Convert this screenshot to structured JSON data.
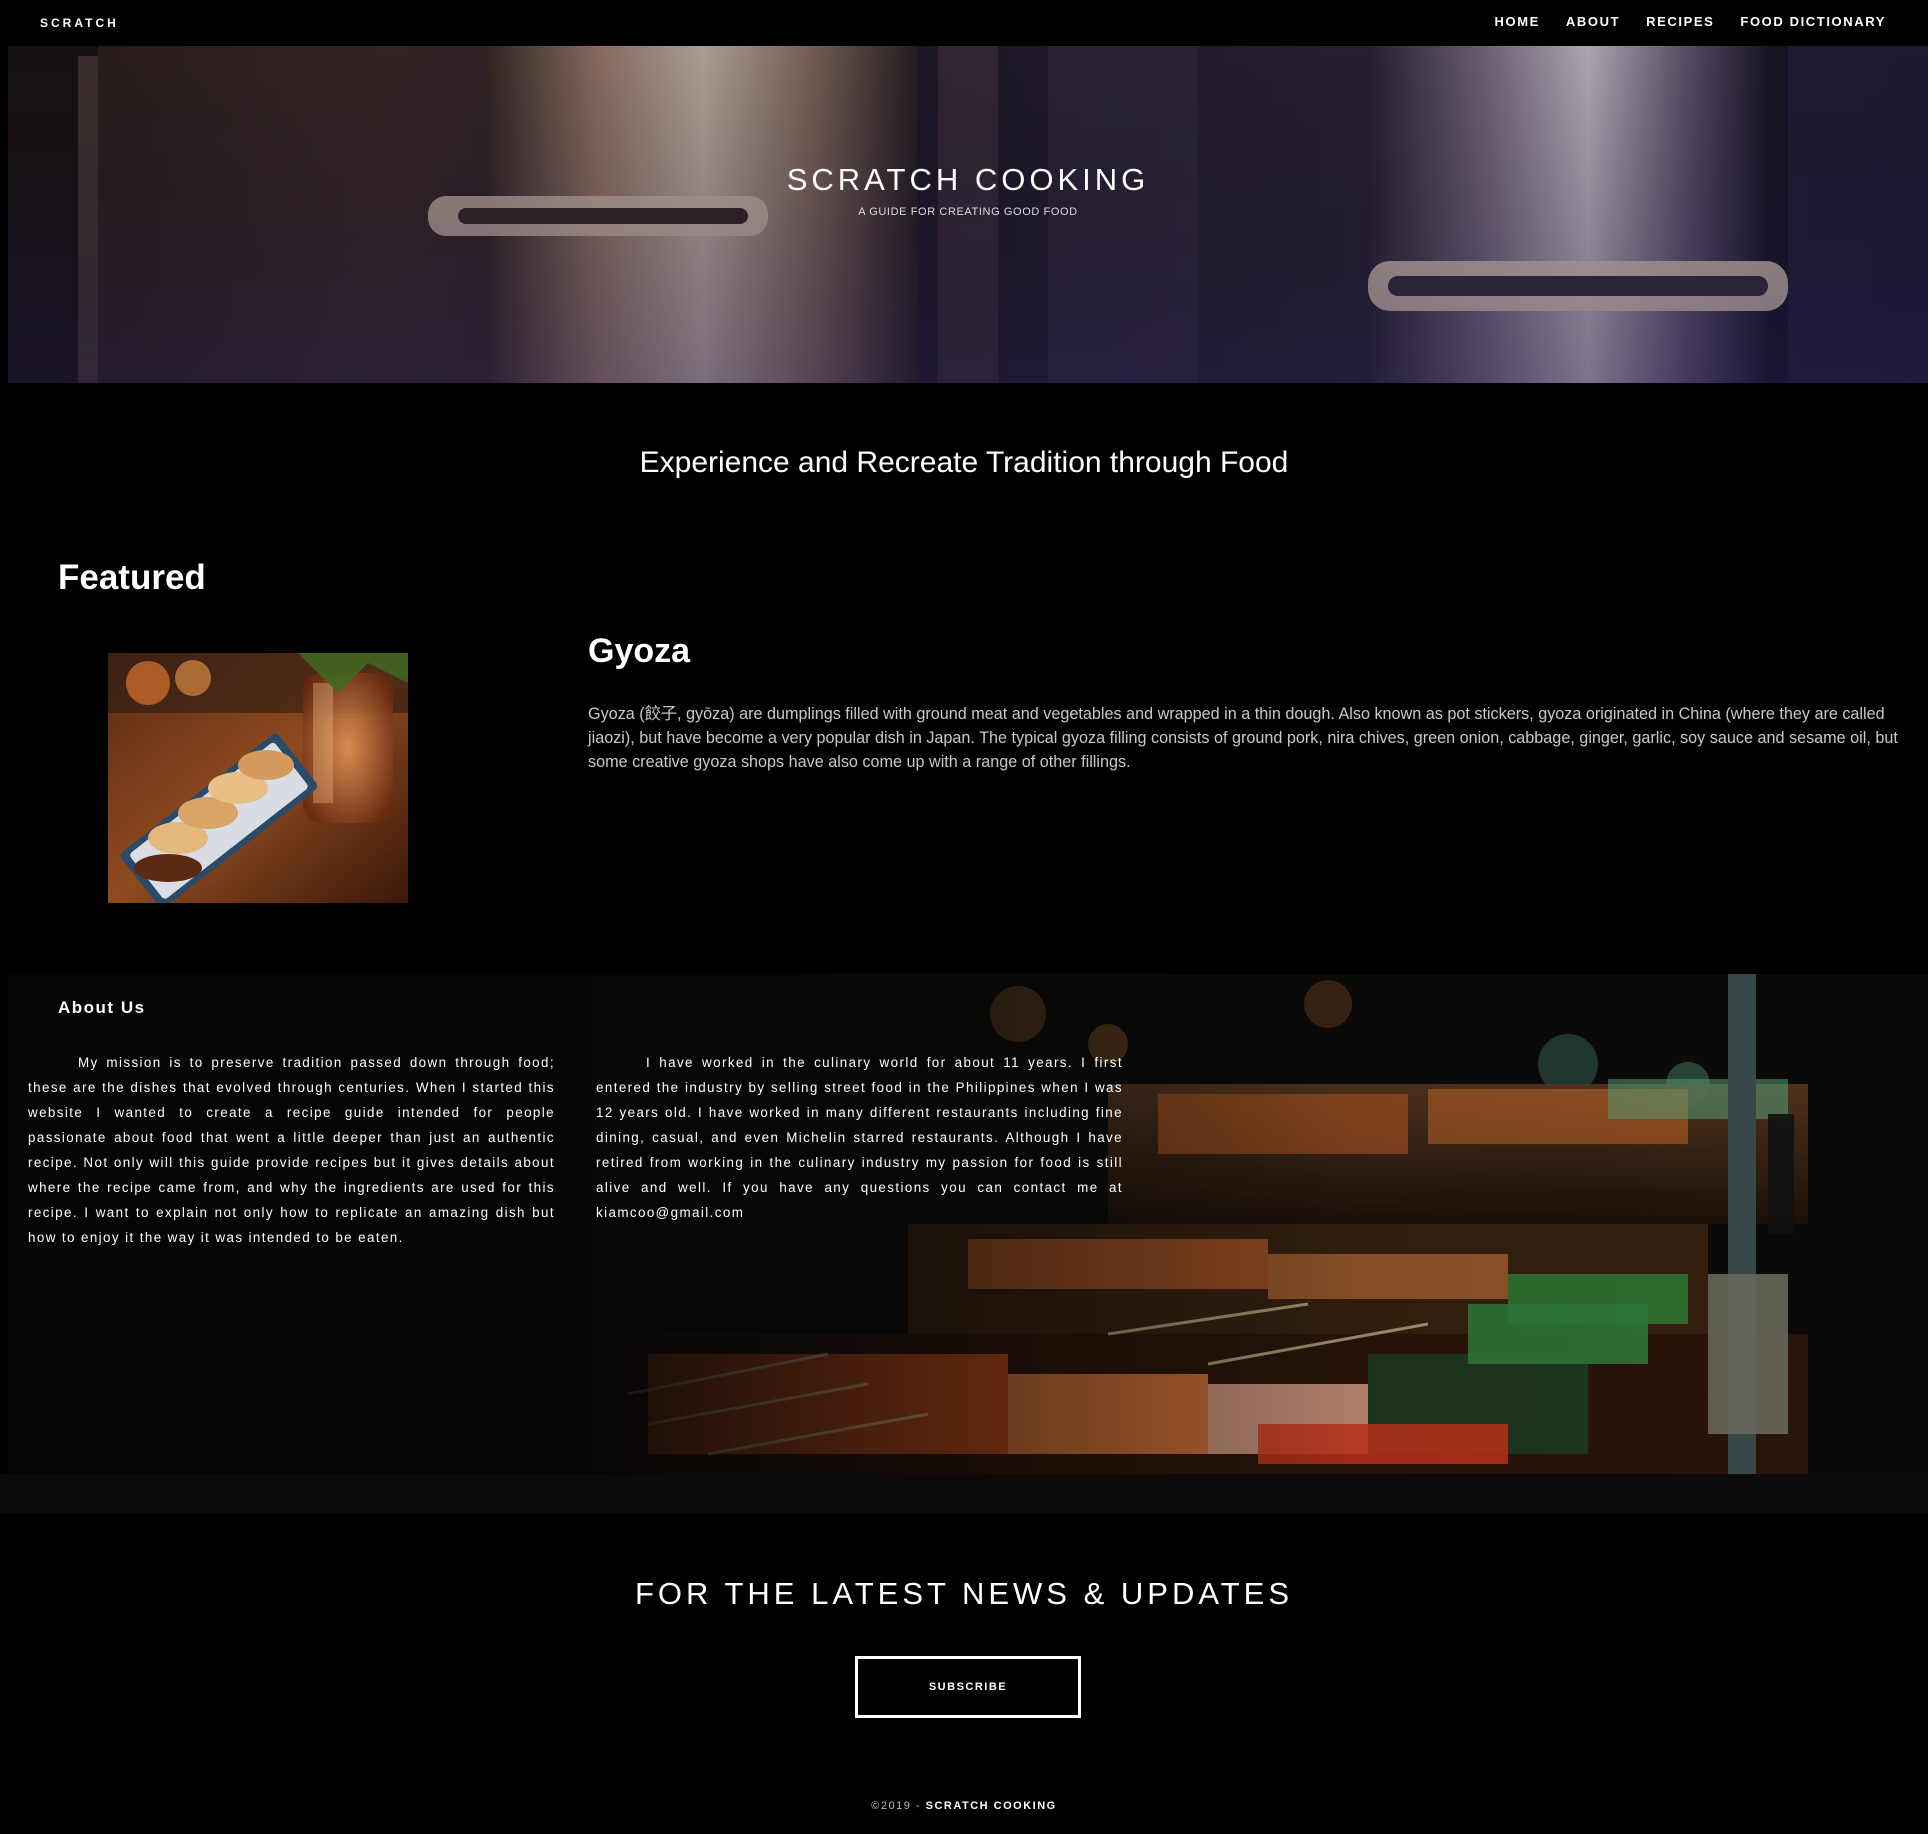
{
  "nav": {
    "brand": "SCRATCH",
    "links": [
      "HOME",
      "ABOUT",
      "RECIPES",
      "FOOD DICTIONARY"
    ]
  },
  "hero": {
    "title": "SCRATCH COOKING",
    "subtitle": "A GUIDE FOR CREATING GOOD FOOD"
  },
  "tagline": "Experience and Recreate Tradition through Food",
  "featured": {
    "heading": "Featured",
    "title": "Gyoza",
    "description": "Gyoza (餃子, gyōza) are dumplings filled with ground meat and vegetables and wrapped in a thin dough. Also known as pot stickers, gyoza originated in China (where they are called jiaozi), but have become a very popular dish in Japan. The typical gyoza filling consists of ground pork, nira chives, green onion, cabbage, ginger, garlic, soy sauce and sesame oil, but some creative gyoza shops have also come up with a range of other fillings."
  },
  "about": {
    "heading": "About Us",
    "paragraph_1": "My mission is to preserve tradition passed down through food; these are the dishes that evolved through centuries. When I started this website I wanted to create a recipe guide intended for people passionate about food that went a little deeper than just an authentic recipe. Not only will this guide provide recipes but it gives details about where the recipe came from, and why the ingredients are used for this recipe. I want to explain not only how to replicate an amazing dish but how to enjoy it the way it was intended to be eaten.",
    "paragraph_2": "I have worked in the culinary world for about 11 years. I first entered the industry by selling street food in the Philippines when I was 12 years old. I have worked in many different restaurants including fine dining, casual, and even Michelin starred restaurants. Although I have retired from working in the culinary industry my passion for food is still alive and well. If you have any questions you can contact me at kiamcoo@gmail.com"
  },
  "newsletter": {
    "heading": "FOR THE LATEST NEWS & UPDATES",
    "button_label": "SUBSCRIBE"
  },
  "footer": {
    "copyright": "©2019 - ",
    "brand": "SCRATCH COOKING"
  },
  "colors": {
    "background": "#000000",
    "text": "#ffffff",
    "muted_text": "#c8c8c8",
    "band": "#0b0b0b"
  }
}
